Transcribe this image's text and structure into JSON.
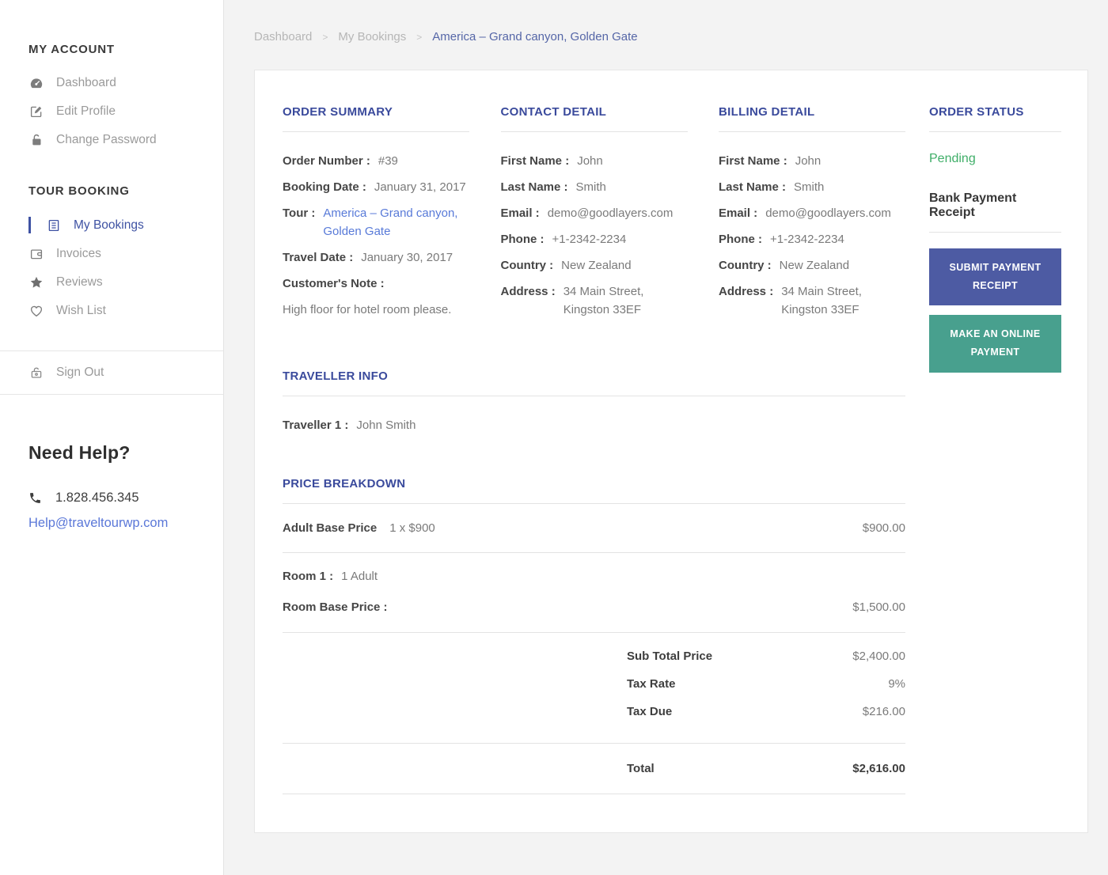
{
  "colors": {
    "heading_accent": "#3a4a9c",
    "active_nav": "#3e52a3",
    "link_blue": "#587ad8",
    "pending_green": "#3fae68",
    "submit_button_bg": "#4d5ba3",
    "online_button_bg": "#48a08e",
    "page_background": "#f3f3f3"
  },
  "sidebar": {
    "account_title": "MY ACCOUNT",
    "account_items": [
      {
        "icon": "dashboard-icon",
        "label": "Dashboard"
      },
      {
        "icon": "edit-icon",
        "label": "Edit Profile"
      },
      {
        "icon": "lock-icon",
        "label": "Change Password"
      }
    ],
    "booking_title": "TOUR BOOKING",
    "booking_items": [
      {
        "icon": "bookings-icon",
        "label": "My Bookings",
        "active": true
      },
      {
        "icon": "invoice-icon",
        "label": "Invoices"
      },
      {
        "icon": "star-icon",
        "label": "Reviews"
      },
      {
        "icon": "heart-icon",
        "label": "Wish List"
      }
    ],
    "sign_out_label": "Sign Out",
    "help_title": "Need Help?",
    "help_phone": "1.828.456.345",
    "help_email": "Help@traveltourwp.com"
  },
  "breadcrumb": {
    "dashboard": "Dashboard",
    "my_bookings": "My Bookings",
    "current": "America – Grand canyon, Golden Gate",
    "separator": ">"
  },
  "order_summary": {
    "title": "ORDER SUMMARY",
    "order_number_label": "Order Number :",
    "order_number": "#39",
    "booking_date_label": "Booking Date :",
    "booking_date": "January 31, 2017",
    "tour_label": "Tour :",
    "tour_line1": "America – Grand canyon,",
    "tour_line2": "Golden Gate",
    "travel_date_label": "Travel Date :",
    "travel_date": "January 30, 2017",
    "customer_note_label": "Customer's Note :",
    "customer_note": "High floor for hotel room please."
  },
  "contact_detail": {
    "title": "CONTACT DETAIL",
    "first_name_label": "First Name :",
    "first_name": "John",
    "last_name_label": "Last Name :",
    "last_name": "Smith",
    "email_label": "Email :",
    "email": "demo@goodlayers.com",
    "phone_label": "Phone :",
    "phone": "+1-2342-2234",
    "country_label": "Country :",
    "country": "New Zealand",
    "address_label": "Address :",
    "address_line1": "34 Main Street,",
    "address_line2": "Kingston 33EF"
  },
  "billing_detail": {
    "title": "BILLING DETAIL",
    "first_name_label": "First Name :",
    "first_name": "John",
    "last_name_label": "Last Name :",
    "last_name": "Smith",
    "email_label": "Email :",
    "email": "demo@goodlayers.com",
    "phone_label": "Phone :",
    "phone": "+1-2342-2234",
    "country_label": "Country :",
    "country": "New Zealand",
    "address_label": "Address :",
    "address_line1": "34 Main Street,",
    "address_line2": "Kingston 33EF"
  },
  "order_status": {
    "title": "ORDER STATUS",
    "status": "Pending",
    "bank_receipt_label": "Bank Payment Receipt",
    "submit_button": "SUBMIT PAYMENT RECEIPT",
    "online_button": "MAKE AN ONLINE PAYMENT"
  },
  "traveller_info": {
    "title": "TRAVELLER INFO",
    "traveller_label": "Traveller 1 :",
    "traveller_name": "John Smith"
  },
  "price_breakdown": {
    "title": "PRICE BREAKDOWN",
    "adult_label": "Adult Base Price",
    "adult_qty": "1 x $900",
    "adult_amount": "$900.00",
    "room_label": "Room 1 :",
    "room_value": "1 Adult",
    "room_price_label": "Room Base Price :",
    "room_price_amount": "$1,500.00",
    "subtotal_label": "Sub Total Price",
    "subtotal": "$2,400.00",
    "tax_rate_label": "Tax Rate",
    "tax_rate": "9%",
    "tax_due_label": "Tax Due",
    "tax_due": "$216.00",
    "total_label": "Total",
    "total": "$2,616.00"
  }
}
